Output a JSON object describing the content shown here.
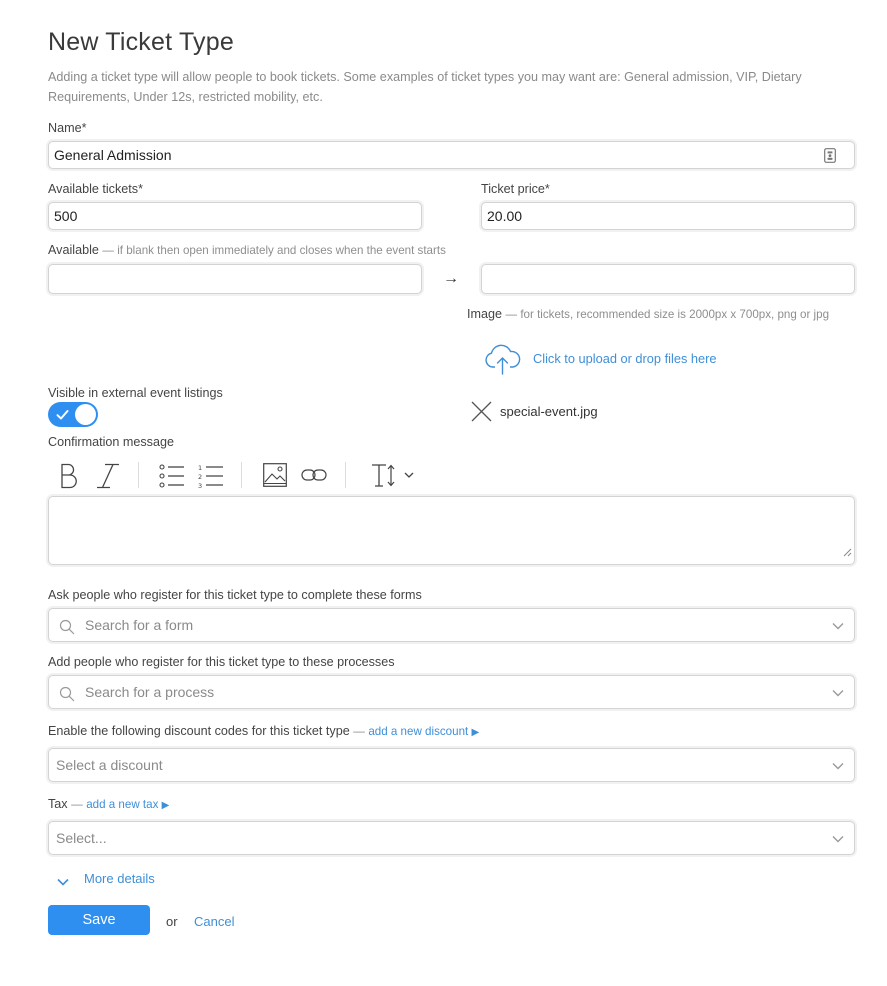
{
  "page": {
    "title": "New Ticket Type",
    "intro": "Adding a ticket type will allow people to book tickets. Some examples of ticket types you may want are: General admission, VIP, Dietary Requirements, Under 12s, restricted mobility, etc."
  },
  "name_field": {
    "label": "Name*",
    "value": "General Admission"
  },
  "available_tickets": {
    "label": "Available tickets*",
    "value": "500"
  },
  "ticket_price": {
    "label": "Ticket price*",
    "value": "20.00"
  },
  "available": {
    "label": "Available",
    "hint": "— if blank then open immediately and closes when the event starts",
    "start_value": "",
    "end_value": "",
    "arrow": "→"
  },
  "image": {
    "label": "Image",
    "hint": "— for tickets, recommended size is 2000px x 700px, png or jpg",
    "upload_text": "Click to upload or drop files here",
    "file_name": "special-event.jpg"
  },
  "visible_listing": {
    "label": "Visible in external event listings",
    "enabled": true
  },
  "confirmation": {
    "label": "Confirmation message",
    "value": ""
  },
  "forms": {
    "label": "Ask people who register for this ticket type to complete these forms",
    "placeholder": "Search for a form"
  },
  "processes": {
    "label": "Add people who register for this ticket type to these processes",
    "placeholder": "Search for a process"
  },
  "discounts": {
    "label": "Enable the following discount codes for this ticket type",
    "dash": "—",
    "add_link": "add a new discount",
    "placeholder": "Select a discount"
  },
  "tax": {
    "label": "Tax",
    "dash": "—",
    "add_link": "add a new tax",
    "placeholder": "Select..."
  },
  "more_details": "More details",
  "actions": {
    "save": "Save",
    "or": "or",
    "cancel": "Cancel"
  },
  "colors": {
    "accent": "#2e8ff0",
    "link": "#3f8fd8"
  }
}
